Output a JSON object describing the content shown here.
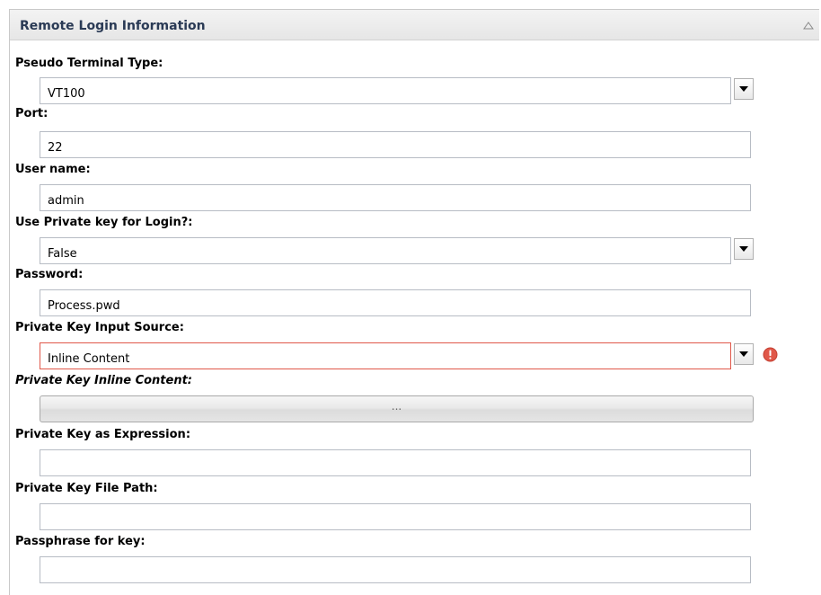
{
  "panel": {
    "title": "Remote Login Information",
    "collapse_icon": "collapse-up-icon"
  },
  "fields": {
    "pseudo_terminal_type": {
      "label": "Pseudo Terminal Type:",
      "value": "VT100"
    },
    "port": {
      "label": "Port:",
      "value": "22"
    },
    "user_name": {
      "label": "User name:",
      "value": "admin"
    },
    "use_private_key": {
      "label": "Use Private key for Login?:",
      "value": "False"
    },
    "password": {
      "label": "Password:",
      "value": "Process.pwd"
    },
    "private_key_input_source": {
      "label": "Private Key Input Source:",
      "value": "Inline Content",
      "status": "error"
    },
    "private_key_inline_content": {
      "label": "Private Key Inline Content:",
      "button_label": "..."
    },
    "private_key_expression": {
      "label": "Private Key as Expression:",
      "value": ""
    },
    "private_key_file_path": {
      "label": "Private Key File Path:",
      "value": ""
    },
    "passphrase": {
      "label": "Passphrase for key:",
      "value": ""
    }
  },
  "icons": {
    "dropdown": "chevron-down-icon",
    "error": "error-icon"
  },
  "colors": {
    "error": "#e0584a",
    "header_text": "#2a3a55"
  }
}
